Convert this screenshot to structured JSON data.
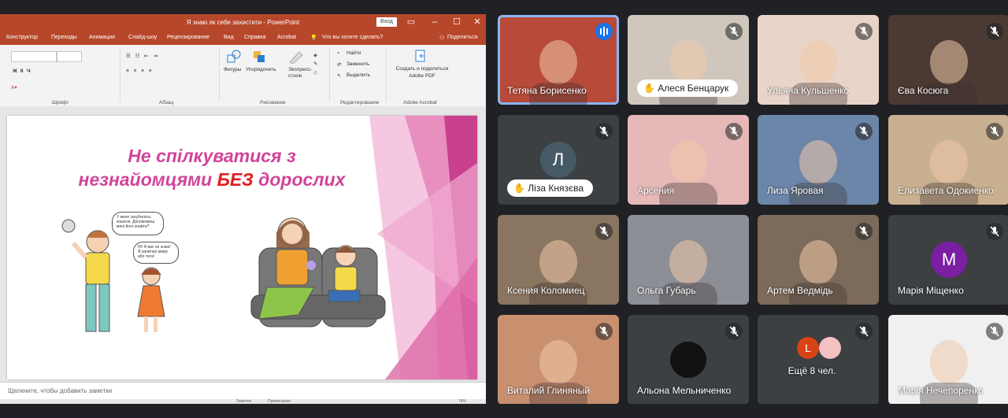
{
  "ppt": {
    "title": "Я знаю як себе захистити  -  PowerPoint",
    "signin": "Вход",
    "menu": [
      "Конструктор",
      "Переходы",
      "Анимация",
      "Слайд-шоу",
      "Рецензирование",
      "Вид",
      "Справка",
      "Acrobat"
    ],
    "tell_me": "Что вы хотите сделать?",
    "share": "Поделиться",
    "ribbon": {
      "font_group": "Шрифт",
      "paragraph_group": "Абзац",
      "drawing_group": "Рисование",
      "editing_group": "Редактирование",
      "acrobat_group": "Adobe Acrobat",
      "shapes": "Фигуры",
      "arrange": "Упорядочить",
      "quick_styles": "Экспресс-стили",
      "find": "Найти",
      "replace": "Заменить",
      "select": "Выделить",
      "create_pdf": "Создать и поделиться Adobe PDF"
    },
    "slide": {
      "title_line1": "Не спілкуватися з",
      "title_line2_pre": "незнайомцями ",
      "title_line2_bold": "БЕЗ",
      "title_line2_post": " дорослих",
      "bubble1": "У мене загубилось кошеня. Допоможеш мені його знайти?",
      "bubble2": "Ні! Я вас не знаю! Я запитаю маму або тата!"
    },
    "notes_placeholder": "Щелкните, чтобы добавить заметки",
    "status": {
      "notes": "Заметки",
      "comments": "Примечания",
      "zoom": "74%"
    }
  },
  "meet": {
    "participants": [
      {
        "name": "Тетяна Борисенко",
        "speaking": true
      },
      {
        "name": "Алеся Бенцарук",
        "hand_raised": true
      },
      {
        "name": "Ульяна Кульшенко",
        "muted": true
      },
      {
        "name": "Єва Косюга",
        "muted": true
      },
      {
        "name": "Ліза Князєва",
        "hand_raised": true,
        "initial": "Л"
      },
      {
        "name": "Арсения",
        "muted": true
      },
      {
        "name": "Лиза Яровая",
        "muted": true
      },
      {
        "name": "Елизавета Одокиенко",
        "muted": true
      },
      {
        "name": "Ксения Коломиец",
        "muted": true
      },
      {
        "name": "Ольга Губарь"
      },
      {
        "name": "Артем Ведмідь",
        "muted": true
      },
      {
        "name": "Марія Міщенко",
        "muted": true,
        "initial": "М"
      },
      {
        "name": "Виталий Глиняный",
        "muted": true
      },
      {
        "name": "Альона Мельниченко",
        "muted": true
      },
      {
        "name": "Ещё 8 чел.",
        "muted": true,
        "initial": "L"
      },
      {
        "name": "Марія Нечепоренко",
        "muted": true
      }
    ]
  },
  "colors": {
    "ppt_accent": "#b7472a",
    "meet_bg": "#202124",
    "tile_bg": "#3c4043",
    "speaking_border": "#8ab4f8",
    "slide_title": "#d0449a",
    "slide_bold": "#e02020"
  }
}
